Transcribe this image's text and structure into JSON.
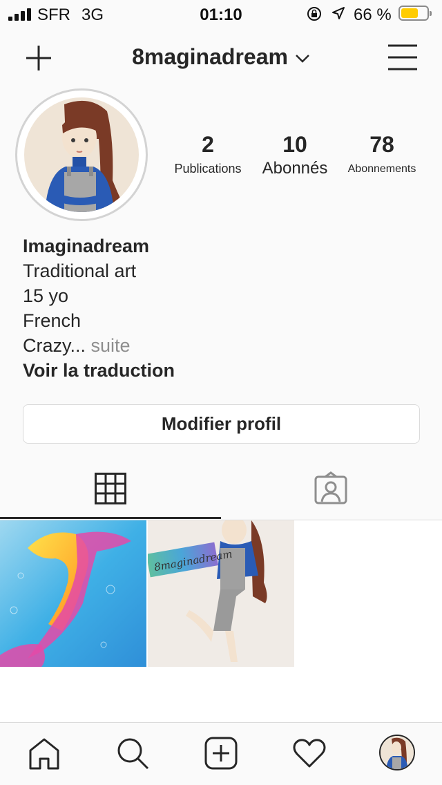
{
  "status_bar": {
    "carrier": "SFR",
    "network": "3G",
    "time": "01:10",
    "battery_percent": "66 %",
    "battery_level": 0.66
  },
  "header": {
    "username": "8maginadream",
    "icons": [
      "plus-icon",
      "chevron-down-icon",
      "hamburger-menu-icon"
    ]
  },
  "stats": {
    "posts_count": "2",
    "posts_label": "Publications",
    "followers_count": "10",
    "followers_label": "Abonnés",
    "following_count": "78",
    "following_label": "Abonnements"
  },
  "bio": {
    "name": "Imaginadream",
    "line1": "Traditional art",
    "line2": "15 yo",
    "line3": "French",
    "line4": "Crazy...",
    "more": "suite",
    "translate": "Voir la traduction"
  },
  "edit_profile_label": "Modifier profil",
  "tabs": [
    "grid-icon",
    "tagged-icon"
  ],
  "posts": [
    {
      "subject": "mermaid watercolor"
    },
    {
      "subject": "girl drawing",
      "caption": "8maginadream"
    }
  ],
  "bottom_nav": [
    "home-icon",
    "search-icon",
    "new-post-icon",
    "heart-icon",
    "profile-avatar"
  ],
  "colors": {
    "text": "#262626",
    "muted": "#8e8e8e",
    "border": "#dbdbdb",
    "battery": "#ffcc00"
  }
}
